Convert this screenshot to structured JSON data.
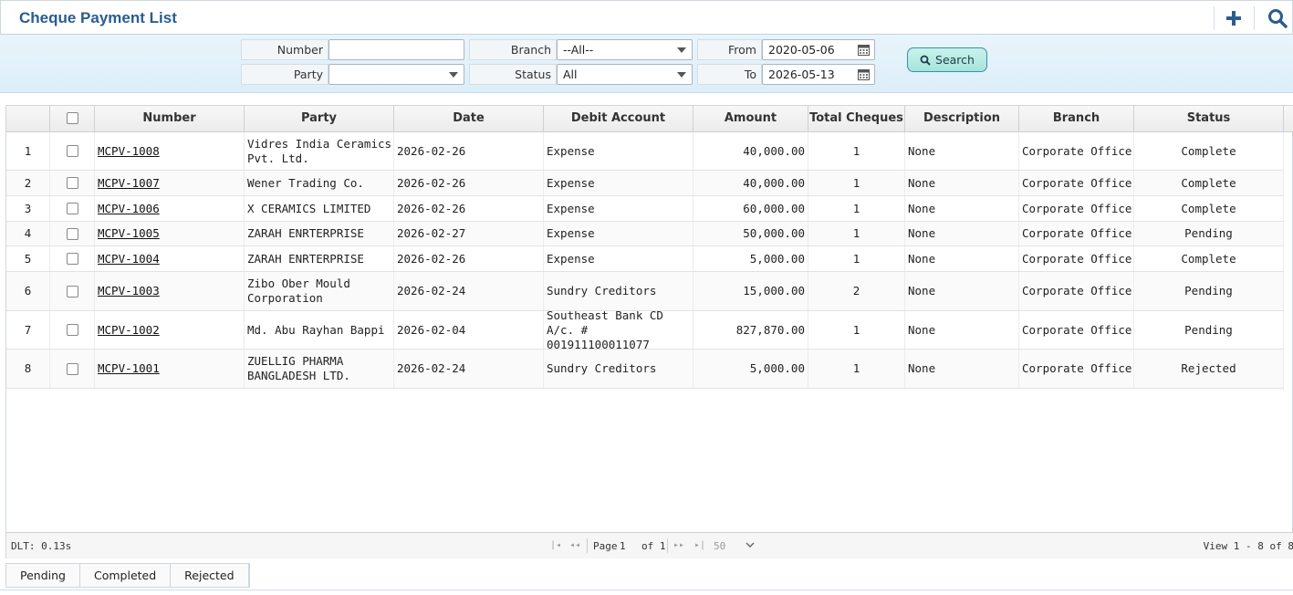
{
  "header": {
    "title": "Cheque Payment List",
    "add_icon": "plus-icon",
    "search_icon": "magnifier-icon"
  },
  "filters": {
    "number_label": "Number",
    "number_value": "",
    "party_label": "Party",
    "party_value": "",
    "branch_label": "Branch",
    "branch_value": "--All--",
    "status_label": "Status",
    "status_value": "All",
    "from_label": "From",
    "from_value": "2020-05-06",
    "to_label": "To",
    "to_value": "2026-05-13",
    "search_label": "Search"
  },
  "table": {
    "columns": [
      "",
      "",
      "Number",
      "Party",
      "Date",
      "Debit Account",
      "Amount",
      "Total Cheques",
      "Description",
      "Branch",
      "Status"
    ],
    "rows": [
      {
        "idx": "1",
        "number": "MCPV-1008",
        "party": "Vidres India Ceramics Pvt. Ltd.",
        "date": "2026-02-26",
        "debit": "Expense",
        "amount": "40,000.00",
        "cheques": "1",
        "desc": "None",
        "branch": "Corporate Office",
        "status": "Complete"
      },
      {
        "idx": "2",
        "number": "MCPV-1007",
        "party": "Wener Trading Co.",
        "date": "2026-02-26",
        "debit": "Expense",
        "amount": "40,000.00",
        "cheques": "1",
        "desc": "None",
        "branch": "Corporate Office",
        "status": "Complete"
      },
      {
        "idx": "3",
        "number": "MCPV-1006",
        "party": "X CERAMICS LIMITED",
        "date": "2026-02-26",
        "debit": "Expense",
        "amount": "60,000.00",
        "cheques": "1",
        "desc": "None",
        "branch": "Corporate Office",
        "status": "Complete"
      },
      {
        "idx": "4",
        "number": "MCPV-1005",
        "party": "ZARAH ENRTERPRISE",
        "date": "2026-02-27",
        "debit": "Expense",
        "amount": "50,000.00",
        "cheques": "1",
        "desc": "None",
        "branch": "Corporate Office",
        "status": "Pending"
      },
      {
        "idx": "5",
        "number": "MCPV-1004",
        "party": "ZARAH ENRTERPRISE",
        "date": "2026-02-26",
        "debit": "Expense",
        "amount": "5,000.00",
        "cheques": "1",
        "desc": "None",
        "branch": "Corporate Office",
        "status": "Complete"
      },
      {
        "idx": "6",
        "number": "MCPV-1003",
        "party": "Zibo Ober Mould Corporation",
        "date": "2026-02-24",
        "debit": "Sundry Creditors",
        "amount": "15,000.00",
        "cheques": "2",
        "desc": "None",
        "branch": "Corporate Office",
        "status": "Pending"
      },
      {
        "idx": "7",
        "number": "MCPV-1002",
        "party": "Md. Abu Rayhan Bappi",
        "date": "2026-02-04",
        "debit": "Southeast  Bank CD A/c. # 001911100011077",
        "amount": "827,870.00",
        "cheques": "1",
        "desc": "None",
        "branch": "Corporate Office",
        "status": "Pending"
      },
      {
        "idx": "8",
        "number": "MCPV-1001",
        "party": "ZUELLIG PHARMA BANGLADESH LTD.",
        "date": "2026-02-24",
        "debit": "Sundry Creditors",
        "amount": "5,000.00",
        "cheques": "1",
        "desc": "None",
        "branch": "Corporate Office",
        "status": "Rejected"
      }
    ]
  },
  "pager": {
    "dlt": "DLT: 0.13s",
    "page_label": "Page",
    "page_value": "1",
    "of_label": "of 1",
    "page_size": "50",
    "view_text": "View 1 - 8 of 8"
  },
  "tabs": [
    "Pending",
    "Completed",
    "Rejected"
  ]
}
